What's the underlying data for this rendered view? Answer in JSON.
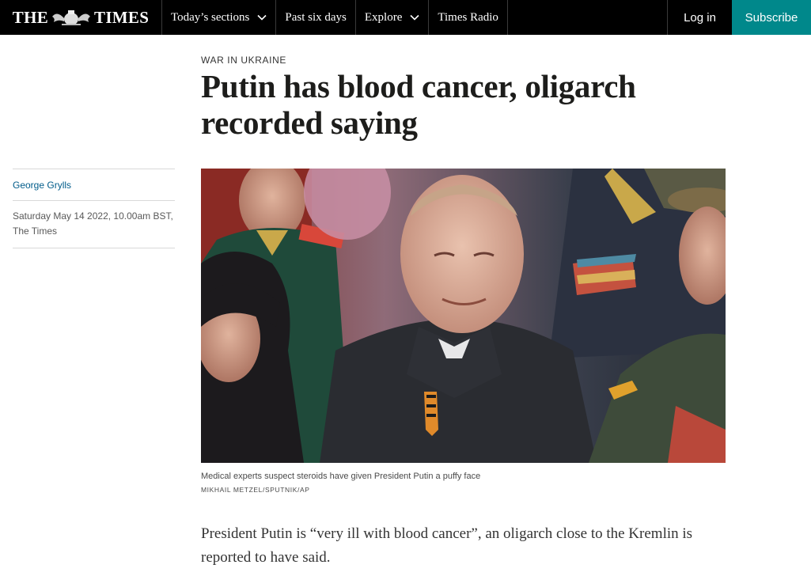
{
  "nav": {
    "logo_left": "THE",
    "logo_right": "TIMES",
    "items": [
      {
        "label": "Today’s sections",
        "has_dropdown": true
      },
      {
        "label": "Past six days",
        "has_dropdown": false
      },
      {
        "label": "Explore",
        "has_dropdown": true
      },
      {
        "label": "Times Radio",
        "has_dropdown": false
      }
    ],
    "login_label": "Log in",
    "subscribe_label": "Subscribe"
  },
  "article": {
    "section": "WAR IN UKRAINE",
    "headline": "Putin has blood cancer, oligarch recorded saying",
    "author": "George Grylls",
    "date_line1": "Saturday May 14 2022, 10.00am BST,",
    "date_line2": "The Times",
    "image_caption": "Medical experts suspect steroids have given President Putin a puffy face",
    "image_credit": "MIKHAIL METZEL/SPUTNIK/AP",
    "lede": "President Putin is “very ill with blood cancer”, an oligarch close to the Kremlin is reported to have said."
  },
  "colors": {
    "nav_background": "#000000",
    "subscribe_teal": "#00888b",
    "author_link": "#005c8a",
    "headline": "#1d1d1b"
  },
  "icons": {
    "logo_crest": "royal-crest-icon",
    "dropdown": "chevron-down-icon"
  }
}
